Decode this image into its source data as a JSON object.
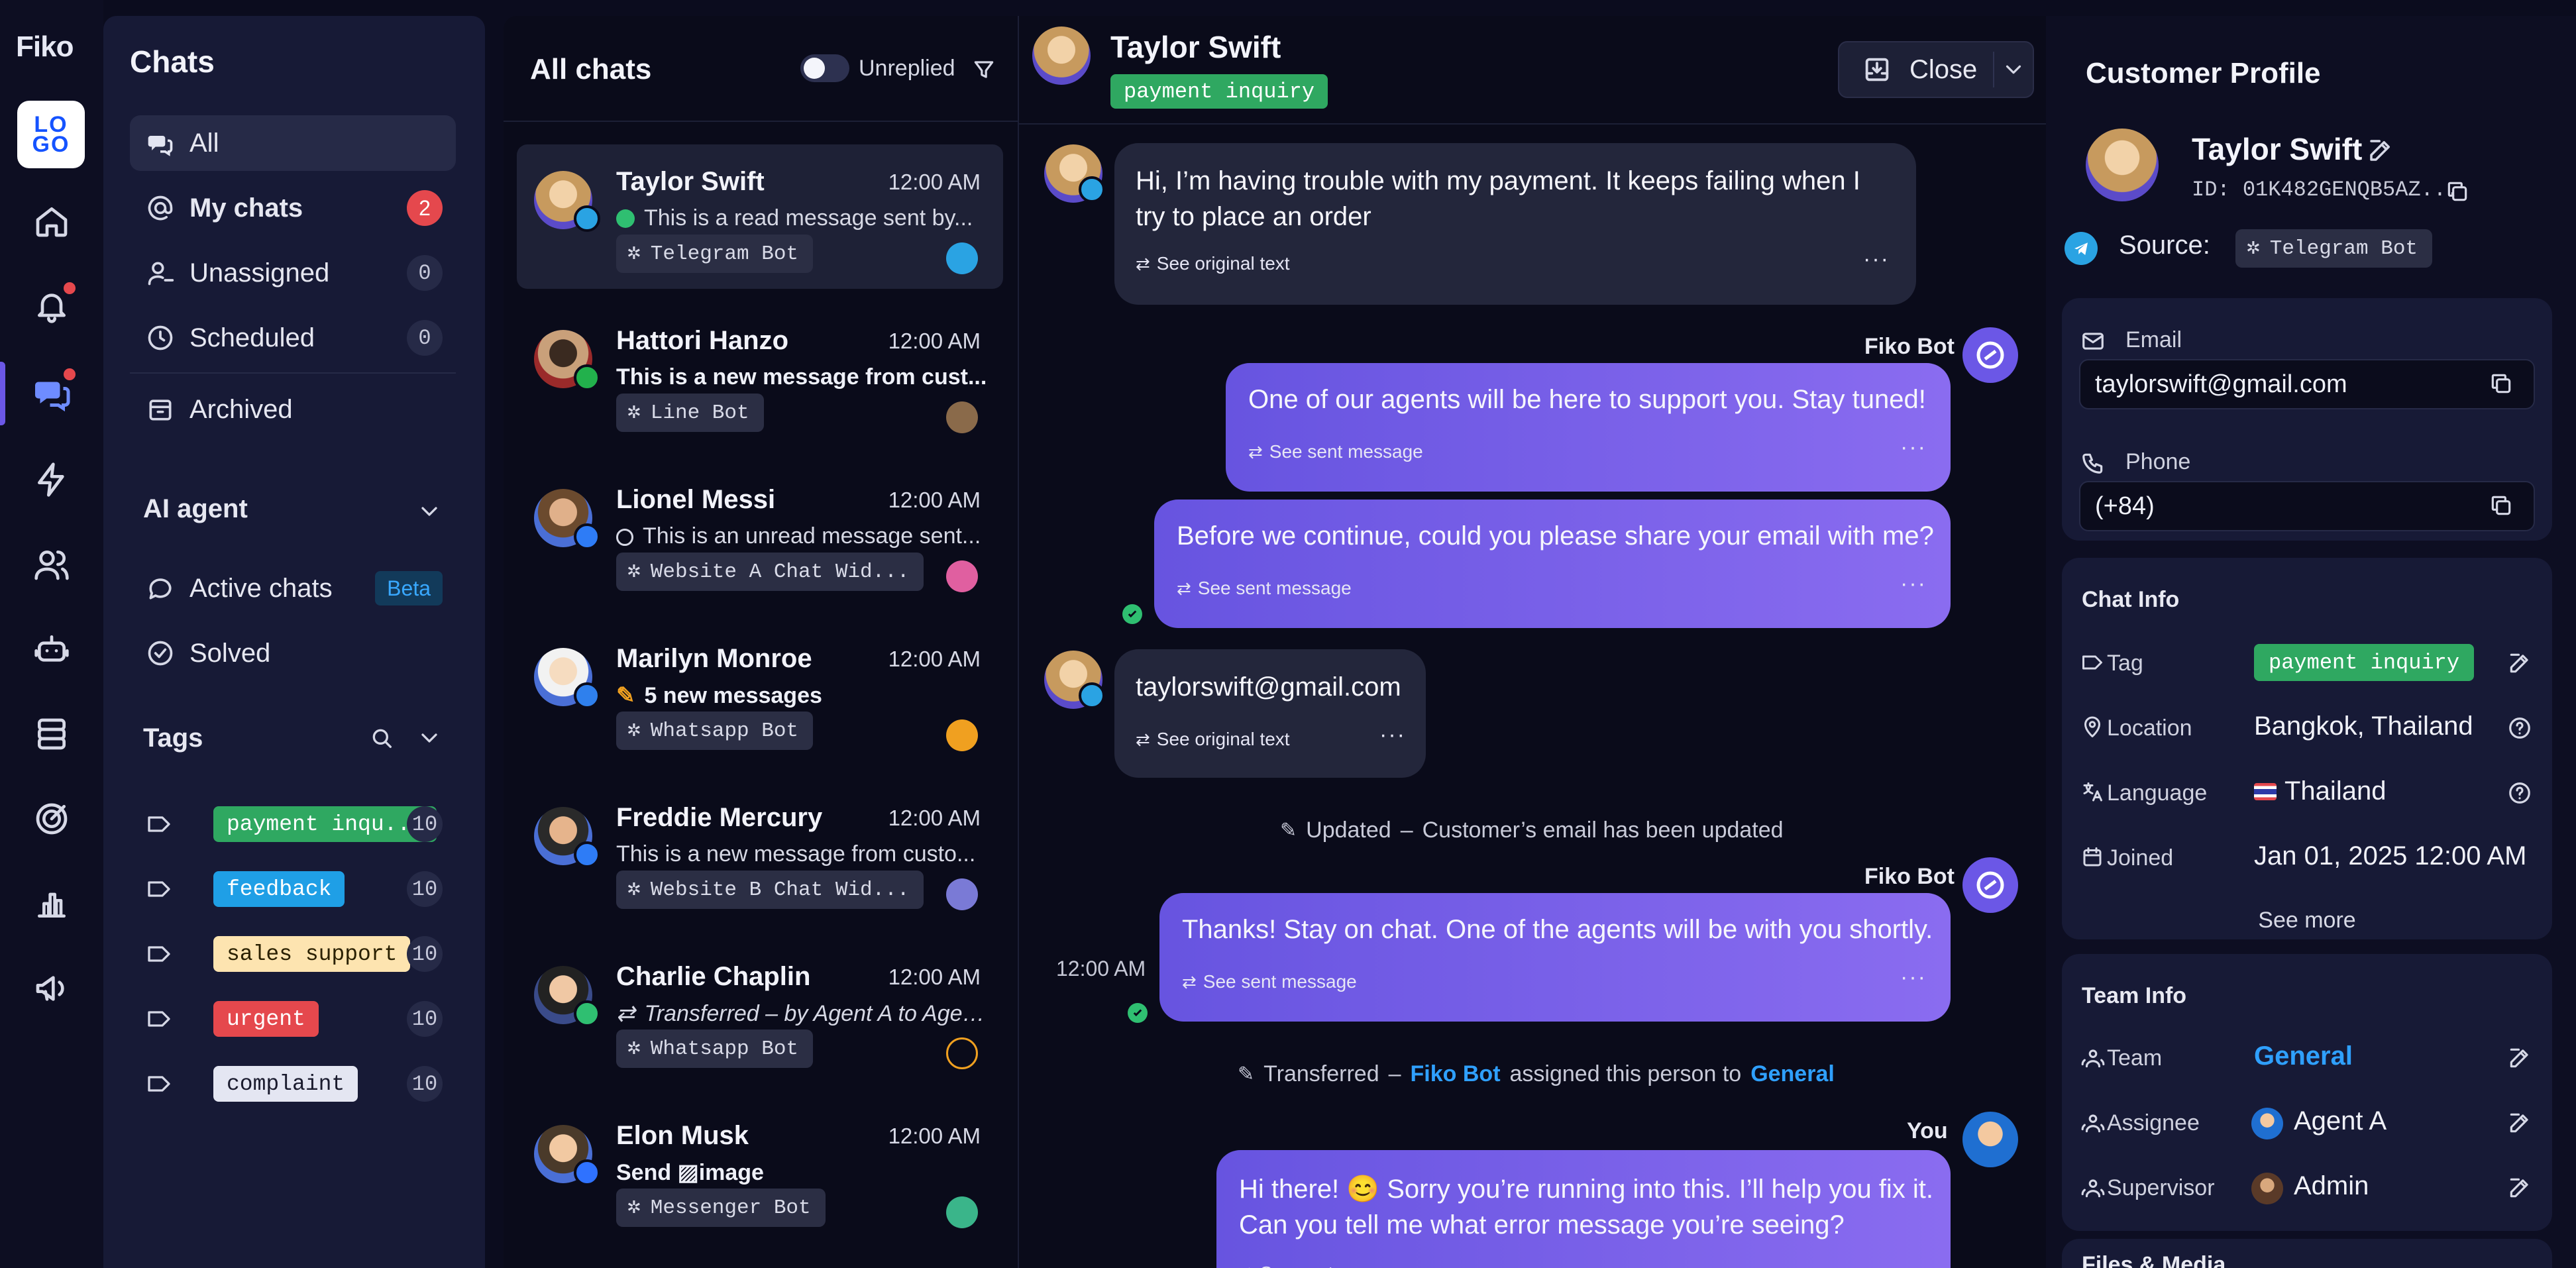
{
  "brand": {
    "logo_text": "Fiko",
    "logo_tile": "LO\nGO"
  },
  "nav": {
    "title": "Chats",
    "items": [
      {
        "label": "All",
        "count": ""
      },
      {
        "label": "My chats",
        "count": "2"
      },
      {
        "label": "Unassigned",
        "count": "0"
      },
      {
        "label": "Scheduled",
        "count": "0"
      },
      {
        "label": "Archived",
        "count": ""
      }
    ],
    "ai_section": "AI agent",
    "ai_items": [
      {
        "label": "Active chats",
        "badge": "Beta"
      },
      {
        "label": "Solved"
      }
    ],
    "tags_section": "Tags",
    "tags": [
      {
        "label": "payment inqu...",
        "count": "10",
        "bg": "#2fa861",
        "fg": "#ffffff"
      },
      {
        "label": "feedback",
        "count": "10",
        "bg": "#1f9fe6",
        "fg": "#ffffff"
      },
      {
        "label": "sales support",
        "count": "10",
        "bg": "#fde4b0",
        "fg": "#2a2000"
      },
      {
        "label": "urgent",
        "count": "10",
        "bg": "#e5484d",
        "fg": "#ffffff"
      },
      {
        "label": "complaint",
        "count": "10",
        "bg": "#e4e6f2",
        "fg": "#1a1b2e"
      }
    ]
  },
  "chatlist": {
    "title": "All chats",
    "filter_label": "Unreplied",
    "items": [
      {
        "name": "Taylor Swift",
        "time": "12:00 AM",
        "message": "This is a read message sent by...",
        "status": "read",
        "source": "Telegram Bot",
        "channel": "telegram"
      },
      {
        "name": "Hattori Hanzo",
        "time": "12:00 AM",
        "message": "This is a new message from cust...",
        "status": "new",
        "source": "Line Bot",
        "channel": "line"
      },
      {
        "name": "Lionel Messi",
        "time": "12:00 AM",
        "message": "This is an unread message sent...",
        "status": "unread",
        "source": "Website A Chat Wid...",
        "channel": "web"
      },
      {
        "name": "Marilyn Monroe",
        "time": "12:00 AM",
        "message": "5 new messages",
        "status": "count",
        "source": "Whatsapp Bot",
        "channel": "zalo"
      },
      {
        "name": "Freddie Mercury",
        "time": "12:00 AM",
        "message": "This is a new message from custo...",
        "status": "plain",
        "source": "Website B Chat Wid...",
        "channel": "web"
      },
      {
        "name": "Charlie Chaplin",
        "time": "12:00 AM",
        "message": "Transferred – by Agent A to Agent...",
        "status": "transfer",
        "source": "Whatsapp Bot",
        "channel": "whatsapp"
      },
      {
        "name": "Elon Musk",
        "time": "12:00 AM",
        "message_prefix": "Send",
        "message": "image",
        "status": "image",
        "source": "Messenger Bot",
        "channel": "messenger"
      }
    ]
  },
  "conversation": {
    "contact_name": "Taylor Swift",
    "contact_tag": "payment inquiry",
    "close_label": "Close",
    "messages": [
      {
        "from": "customer",
        "text_lines": [
          "Hi, I’m having trouble with my payment. It keeps failing when I",
          "try to place an order"
        ],
        "meta": "See original text"
      },
      {
        "from": "bot",
        "sender": "Fiko Bot",
        "text_lines": [
          "One of our agents will be here to support you. Stay tuned!"
        ],
        "meta": "See sent message"
      },
      {
        "from": "bot",
        "text_lines": [
          "Before we continue, could you please share your email with me?"
        ],
        "meta": "See sent message"
      },
      {
        "from": "customer",
        "text_lines": [
          "taylorswift@gmail.com"
        ],
        "meta": "See original text"
      },
      {
        "from": "bot",
        "sender": "Fiko Bot",
        "time": "12:00 AM",
        "text_lines": [
          "Thanks! Stay on chat. One of the agents will be with you shortly."
        ],
        "meta": "See sent message"
      },
      {
        "from": "agent",
        "sender": "You",
        "text_lines": [
          "Hi there! 😊 Sorry you’re running into this. I’ll help you fix it.",
          "Can you tell me what error message you’re seeing?"
        ],
        "meta": "See sent message"
      }
    ],
    "system_updated": {
      "kind": "Updated",
      "dash": "–",
      "text": "Customer’s email  has been updated"
    },
    "system_transferred": {
      "kind": "Transferred",
      "dash": "–",
      "actor": "Fiko Bot",
      "middle": "assigned this person to",
      "target": "General"
    }
  },
  "profile": {
    "title": "Customer Profile",
    "name": "Taylor Swift",
    "id": "ID: 01K482GENQB5AZ...",
    "source_label": "Source:",
    "source_value": "Telegram Bot",
    "email_label": "Email",
    "email_value": "taylorswift@gmail.com",
    "phone_label": "Phone",
    "phone_value": "(+84)",
    "chat_info_title": "Chat Info",
    "tag_label": "Tag",
    "tag_value": "payment inquiry",
    "location_label": "Location",
    "location_value": "Bangkok, Thailand",
    "language_label": "Language",
    "language_value": "Thailand",
    "joined_label": "Joined",
    "joined_value": "Jan 01, 2025 12:00 AM",
    "see_more": "See more",
    "team_info_title": "Team Info",
    "team_label": "Team",
    "team_value": "General",
    "assignee_label": "Assignee",
    "assignee_value": "Agent A",
    "supervisor_label": "Supervisor",
    "supervisor_value": "Admin",
    "files_title": "Files & Media"
  },
  "colors": {
    "accent": "#6b57e6",
    "green": "#2fa861",
    "link": "#2fa0ff",
    "badge_red": "#e5484d"
  }
}
